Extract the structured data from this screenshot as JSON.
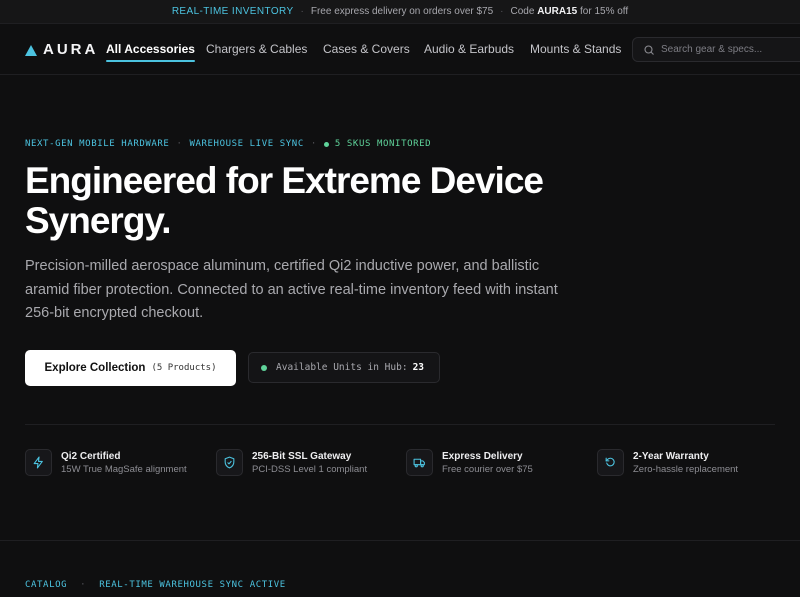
{
  "colors": {
    "accent": "#4cc3e0",
    "live": "#5fd39a",
    "background": "#0f0f10",
    "primary_button": "#ffffff"
  },
  "announcement": {
    "tag": "REAL-TIME INVENTORY",
    "shipping": "Free express delivery on orders over $75",
    "promo_prefix": "Code",
    "promo_code": "AURA15",
    "promo_suffix": "for 15% off"
  },
  "brand": {
    "name": "AURA",
    "icon": "triangle-logo-icon"
  },
  "nav": {
    "links": [
      "All Accessories",
      "Chargers & Cables",
      "Cases & Covers",
      "Audio & Earbuds",
      "Mounts & Stands"
    ],
    "active_index": 0,
    "search_placeholder": "Search gear & specs...",
    "search_value": "",
    "search_icon": "search-icon"
  },
  "hero": {
    "eyebrow": [
      "NEXT-GEN MOBILE HARDWARE",
      "WAREHOUSE LIVE SYNC",
      "5 SKUS MONITORED"
    ],
    "headline": "Engineered for Extreme Device Synergy.",
    "lede": "Precision-milled aerospace aluminum, certified Qi2 inductive power, and ballistic aramid fiber protection. Connected to an active real-time inventory feed with instant 256-bit encrypted checkout.",
    "cta_label": "Explore Collection",
    "cta_count": "(5 Products)",
    "stock_label": "Available Units in Hub:",
    "stock_value": "23"
  },
  "features": [
    {
      "title": "Qi2 Certified",
      "subtitle": "15W True MagSafe alignment",
      "icon": "lightning-icon"
    },
    {
      "title": "256-Bit SSL Gateway",
      "subtitle": "PCI-DSS Level 1 compliant",
      "icon": "shield-check-icon"
    },
    {
      "title": "Express Delivery",
      "subtitle": "Free courier over $75",
      "icon": "truck-icon"
    },
    {
      "title": "2-Year Warranty",
      "subtitle": "Zero-hassle replacement",
      "icon": "rotate-ccw-icon"
    }
  ],
  "catalog": {
    "eyebrow": [
      "CATALOG",
      "REAL-TIME WAREHOUSE SYNC ACTIVE"
    ]
  }
}
